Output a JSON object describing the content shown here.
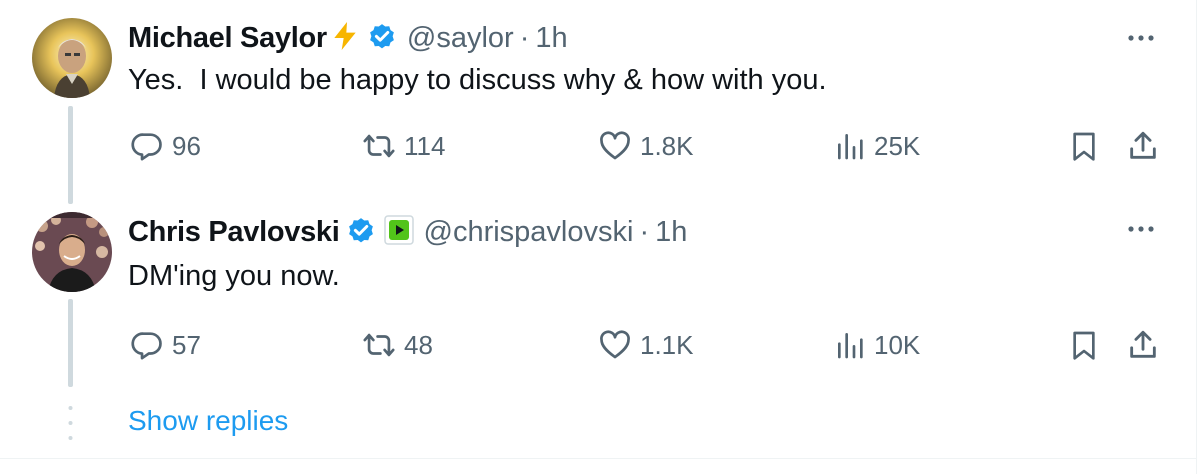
{
  "tweets": [
    {
      "display_name": "Michael Saylor",
      "badge_emoji_icon": "lightning-bolt-icon",
      "handle": "@saylor",
      "separator": "·",
      "time": "1h",
      "text": "Yes.  I would be happy to discuss why & how with you.",
      "replies": "96",
      "reposts": "114",
      "likes": "1.8K",
      "views": "25K"
    },
    {
      "display_name": "Chris Pavlovski",
      "handle": "@chrispavlovski",
      "separator": "·",
      "time": "1h",
      "text": "DM'ing you now.",
      "replies": "57",
      "reposts": "48",
      "likes": "1.1K",
      "views": "10K"
    }
  ],
  "show_replies": "Show replies",
  "colors": {
    "accent": "#1d9bf0",
    "verified": "#1d9bf0",
    "muted": "#536471",
    "text": "#0f1419",
    "thread_line": "#cfd9de",
    "bolt": "#f7b500",
    "affiliate_badge": "#52c41a"
  }
}
